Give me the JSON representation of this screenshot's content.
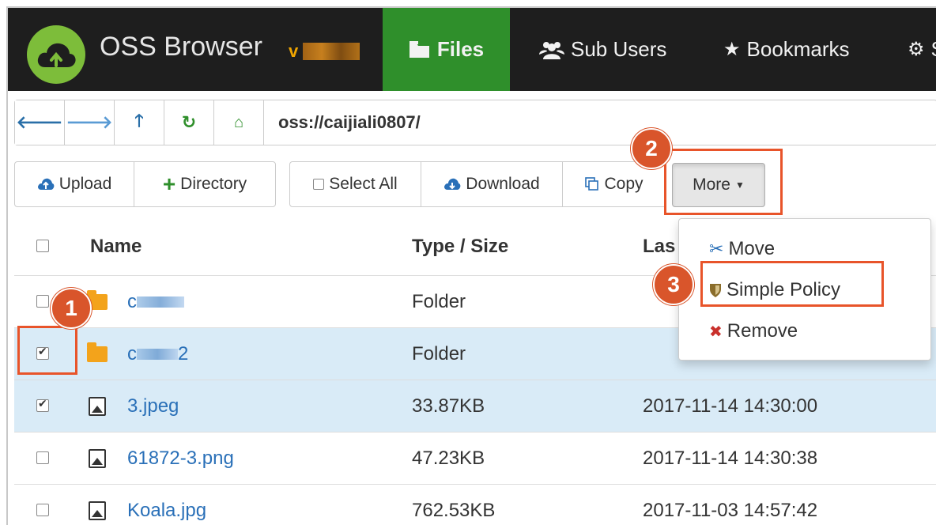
{
  "navbar": {
    "app_title": "OSS Browser",
    "version_prefix": "v",
    "tabs": [
      {
        "label": "Files",
        "icon": "folder-open-icon",
        "active": true
      },
      {
        "label": "Sub Users",
        "icon": "users-icon",
        "active": false
      },
      {
        "label": "Bookmarks",
        "icon": "star-icon",
        "active": false
      },
      {
        "label": "S",
        "icon": "gear-icon",
        "active": false
      }
    ]
  },
  "address": {
    "path": "oss://caijiali0807/"
  },
  "toolbar": {
    "upload_label": "Upload",
    "directory_label": "Directory",
    "select_all_label": "Select All",
    "download_label": "Download",
    "copy_label": "Copy",
    "more_label": "More"
  },
  "table": {
    "headers": {
      "name": "Name",
      "type_size": "Type / Size",
      "last_modified": "Las"
    },
    "rows": [
      {
        "name": "c",
        "type": "folder",
        "type_size": "Folder",
        "date": "",
        "checked": false,
        "selected": false
      },
      {
        "name": "c",
        "name_suffix": "2",
        "type": "folder",
        "type_size": "Folder",
        "date": "",
        "checked": true,
        "selected": true
      },
      {
        "name": "3.jpeg",
        "type": "image",
        "type_size": "33.87KB",
        "date": "2017-11-14 14:30:00",
        "checked": true,
        "selected": true
      },
      {
        "name": "61872-3.png",
        "type": "image",
        "type_size": "47.23KB",
        "date": "2017-11-14 14:30:38",
        "checked": false,
        "selected": false
      },
      {
        "name": "Koala.jpg",
        "type": "image",
        "type_size": "762.53KB",
        "date": "2017-11-03 14:57:42",
        "checked": false,
        "selected": false
      }
    ]
  },
  "more_menu": {
    "items": [
      {
        "label": "Move",
        "icon": "scissors-icon"
      },
      {
        "label": "Simple Policy",
        "icon": "shield-icon"
      },
      {
        "label": "Remove",
        "icon": "close-icon"
      }
    ]
  },
  "annotations": {
    "step1": "1",
    "step2": "2",
    "step3": "3"
  },
  "colors": {
    "navbar_bg": "#1e1e1e",
    "active_tab": "#2f8f2b",
    "logo": "#7dbd3a",
    "link": "#2a70b8",
    "selected_row": "#d9ebf7",
    "annotation": "#e8542a"
  }
}
